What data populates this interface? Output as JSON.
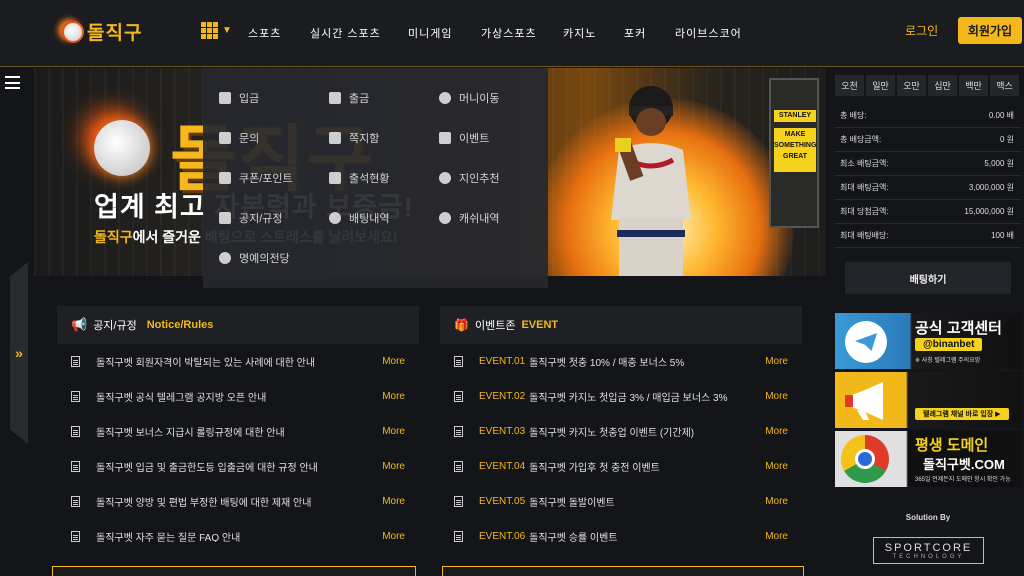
{
  "header": {
    "logo_text": "돌직구",
    "nav": [
      "스포츠",
      "실시간 스포츠",
      "미니게임",
      "가상스포츠",
      "카지노",
      "포커",
      "라이브스코어"
    ],
    "login_label": "로그인",
    "join_label": "회원가입"
  },
  "banner": {
    "logo_text": "돌직구",
    "headline": "업계 최고 자본력과 보증금!",
    "sub_highlight": "돌직구",
    "sub_rest": "에서 즐거운 배팅으로 스트레스를 날려보세요!",
    "sign_words": [
      "STANLEY",
      "MAKE SOMETHING GREAT"
    ]
  },
  "dropdown": {
    "items": [
      "입금",
      "출금",
      "머니이동",
      "문의",
      "쪽지함",
      "이벤트",
      "쿠폰/포인트",
      "출석현황",
      "지인추천",
      "공지/규정",
      "배팅내역",
      "캐쉬내역",
      "명예의전당"
    ]
  },
  "notice": {
    "title": "공지/규정",
    "title_en": "Notice/Rules",
    "more_label": "More",
    "rows": [
      "돌직구벳 회원자격이 박탈되는 있는 사례에 대한 안내",
      "돌직구벳 공식 텔레그램 공지방 오픈 안내",
      "돌직구벳 보너스 지급시 롤링규정에 대한 안내",
      "돌직구벳 입금 및 출금한도등 입출금에 대한 규정 안내",
      "돌직구벳 양방 및 편법 부정한 배팅에 대한 제재 안내",
      "돌직구벳 자주 묻는 질문 FAQ 안내"
    ]
  },
  "event": {
    "title": "이벤트존",
    "title_en": "EVENT",
    "more_label": "More",
    "rows": [
      {
        "no": "EVENT.01",
        "text": "돌직구벳 첫충 10% / 매충 보너스 5%"
      },
      {
        "no": "EVENT.02",
        "text": "돌직구벳 카지노 첫입금 3% / 매입금 보너스 3%"
      },
      {
        "no": "EVENT.03",
        "text": "돌직구벳 카지노 첫충업 이벤트 (기간제)"
      },
      {
        "no": "EVENT.04",
        "text": "돌직구벳 가입후 첫 충전 이벤트"
      },
      {
        "no": "EVENT.05",
        "text": "돌직구벳 돌발이벤트"
      },
      {
        "no": "EVENT.06",
        "text": "돌직구벳 승률 이벤트"
      }
    ]
  },
  "betslip": {
    "tabs": [
      "오천",
      "일만",
      "오만",
      "십만",
      "백만",
      "맥스"
    ],
    "rows": [
      {
        "label": "총 배당:",
        "value": "0.00 배"
      },
      {
        "label": "총 배당금액:",
        "value": "0 원"
      },
      {
        "label": "최소 배팅금액:",
        "value": "5,000 원"
      },
      {
        "label": "최대 배팅금액:",
        "value": "3,000,000 원"
      },
      {
        "label": "최대 당첨금액:",
        "value": "15,000,000 원"
      },
      {
        "label": "최대 배팅배당:",
        "value": "100 배"
      }
    ],
    "bet_label": "배팅하기"
  },
  "ads": {
    "telegram_title": "공식 고객센터",
    "telegram_handle": "@binanbet",
    "telegram_note": "※ 사칭 텔레그램 주의요망",
    "channel_label": "텔레그램 채널 바로 입장 ▶",
    "domain_title": "평생 도메인",
    "domain_name": "돌직구벳.COM",
    "domain_note": "365일 언제든지 도메인 항시 확인 가능"
  },
  "footer": {
    "solution_by": "Solution By",
    "brand": "SPORTCORE",
    "brand_sub": "TECHNOLOGY"
  },
  "colors": {
    "accent": "#f5b81c",
    "background": "#141518"
  }
}
